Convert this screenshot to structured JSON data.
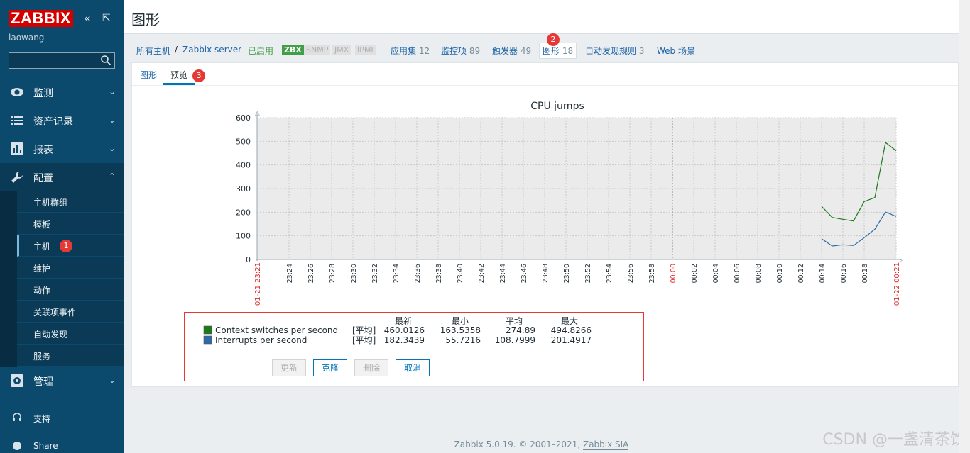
{
  "sidebar": {
    "logo": "ZABBIX",
    "collapse_glyph": "«",
    "expand_glyph": "⇱",
    "username": "laowang",
    "menu": [
      {
        "label": "监测"
      },
      {
        "label": "资产记录"
      },
      {
        "label": "报表"
      },
      {
        "label": "配置"
      },
      {
        "label": "管理"
      }
    ],
    "config_items": [
      "主机群组",
      "模板",
      "主机",
      "维护",
      "动作",
      "关联项事件",
      "自动发现",
      "服务"
    ],
    "bottom": [
      {
        "label": "支持"
      },
      {
        "label": "Share"
      }
    ],
    "badge_1": "1"
  },
  "header": {
    "title": "图形"
  },
  "hostnav": {
    "all_hosts": "所有主机",
    "sep": "/",
    "host": "Zabbix server",
    "status": "已启用",
    "protocols": [
      "ZBX",
      "SNMP",
      "JMX",
      "IPMI"
    ],
    "applications": "应用集",
    "applications_count": "12",
    "items": "监控项",
    "items_count": "89",
    "triggers": "触发器",
    "triggers_count": "49",
    "graphs": "图形",
    "graphs_count": "18",
    "discovery": "自动发现规则",
    "discovery_count": "3",
    "web": "Web 场景",
    "badge_2": "2"
  },
  "tabs": {
    "graph": "图形",
    "preview": "预览",
    "badge_3": "3"
  },
  "chart_data": {
    "type": "line",
    "title": "CPU jumps",
    "ylim": [
      0,
      600
    ],
    "yticks": [
      "600",
      "500",
      "400",
      "300",
      "200",
      "100",
      "0"
    ],
    "xticks": [
      "23:24",
      "23:26",
      "23:28",
      "23:30",
      "23:32",
      "23:34",
      "23:36",
      "23:38",
      "23:40",
      "23:42",
      "23:44",
      "23:46",
      "23:48",
      "23:50",
      "23:52",
      "23:54",
      "23:56",
      "23:58",
      "00:00",
      "00:02",
      "00:04",
      "00:06",
      "00:08",
      "00:10",
      "00:12",
      "00:14",
      "00:16",
      "00:18"
    ],
    "x_start_label": "01-21 23:21",
    "x_end_label": "01-22 00:21",
    "series": [
      {
        "name": "Context switches per second",
        "color": "#1a7a1a",
        "x": [
          "00:14",
          "00:15",
          "00:16",
          "00:17",
          "00:18",
          "00:19",
          "00:20",
          "00:21"
        ],
        "values": [
          225,
          178,
          170,
          163,
          245,
          262,
          495,
          460
        ]
      },
      {
        "name": "Interrupts per second",
        "color": "#2e6aa8",
        "x": [
          "00:14",
          "00:15",
          "00:16",
          "00:17",
          "00:18",
          "00:19",
          "00:20",
          "00:21"
        ],
        "values": [
          88,
          57,
          62,
          59,
          92,
          128,
          201,
          182
        ]
      }
    ],
    "legend_headers": [
      "最新",
      "最小",
      "平均",
      "最大"
    ],
    "legend_rows": [
      {
        "name": "Context switches per second",
        "func": "[平均]",
        "last": "460.0126",
        "min": "163.5358",
        "avg": "274.89",
        "max": "494.8266"
      },
      {
        "name": "Interrupts per second",
        "func": "[平均]",
        "last": "182.3439",
        "min": "55.7216",
        "avg": "108.7999",
        "max": "201.4917"
      }
    ]
  },
  "buttons": {
    "update": "更新",
    "clone": "克隆",
    "delete": "删除",
    "cancel": "取消"
  },
  "footer": {
    "text": "Zabbix 5.0.19. © 2001–2021, ",
    "link": "Zabbix SIA"
  },
  "watermark": "CSDN @一盏清茶饮"
}
